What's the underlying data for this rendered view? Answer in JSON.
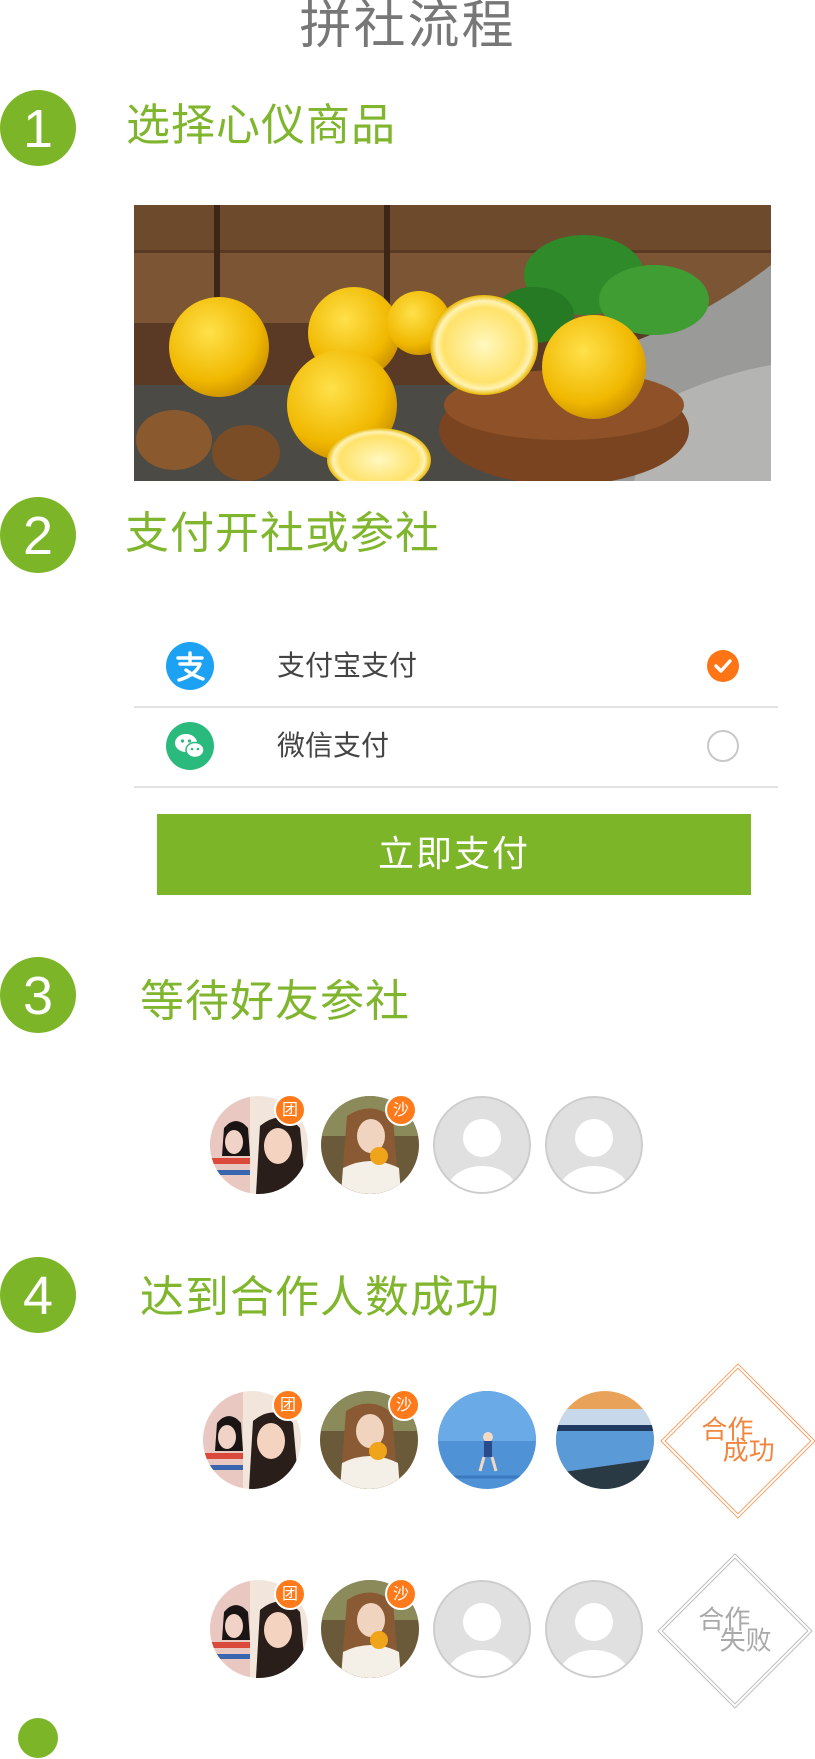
{
  "page_title": "拼社流程",
  "colors": {
    "accent": "#7cb527",
    "badge": "#ff7a1a",
    "checked": "#ff7415",
    "alipay": "#1da1f2",
    "wechat": "#2bba7e"
  },
  "steps": [
    {
      "number": "1",
      "title": "选择心仪商品"
    },
    {
      "number": "2",
      "title": "支付开社或参社"
    },
    {
      "number": "3",
      "title": "等待好友参社"
    },
    {
      "number": "4",
      "title": "达到合作人数成功"
    }
  ],
  "product": {
    "image": "lemons-in-wooden-bowl"
  },
  "payment": {
    "options": [
      {
        "label": "支付宝支付",
        "icon": "alipay-icon",
        "selected": true
      },
      {
        "label": "微信支付",
        "icon": "wechat-icon",
        "selected": false
      }
    ],
    "pay_button": "立即支付"
  },
  "badges": {
    "leader": "团",
    "member": "沙"
  },
  "stamps": {
    "success": [
      "合作",
      "成功"
    ],
    "fail": [
      "合作",
      "失败"
    ]
  }
}
